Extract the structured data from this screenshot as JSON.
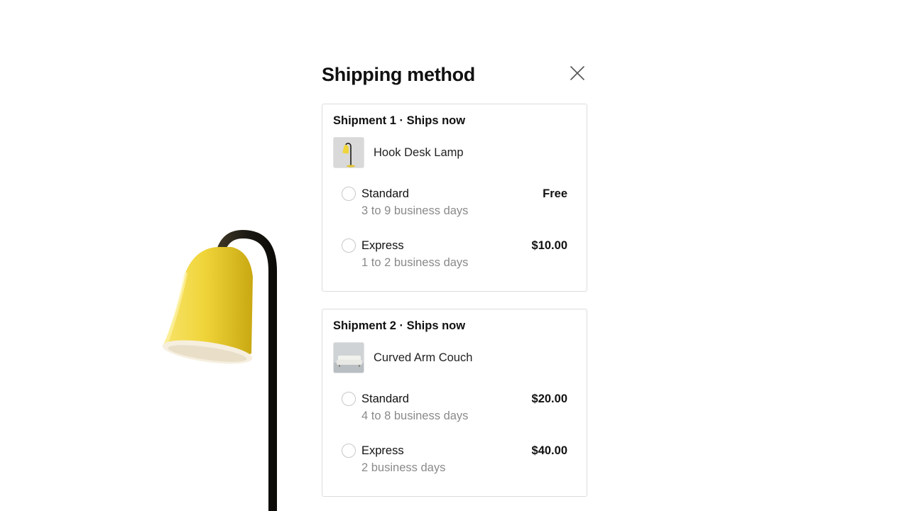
{
  "modal": {
    "title": "Shipping method",
    "close_icon": "close-icon"
  },
  "shipments": [
    {
      "title": "Shipment 1 · Ships now",
      "product": {
        "name": "Hook Desk Lamp",
        "thumbnail": "lamp-thumbnail"
      },
      "options": [
        {
          "label": "Standard",
          "description": "3 to 9 business days",
          "price": "Free"
        },
        {
          "label": "Express",
          "description": "1 to 2 business days",
          "price": "$10.00"
        }
      ]
    },
    {
      "title": "Shipment 2 · Ships now",
      "product": {
        "name": "Curved Arm Couch",
        "thumbnail": "couch-thumbnail"
      },
      "options": [
        {
          "label": "Standard",
          "description": "4 to 8 business days",
          "price": "$20.00"
        },
        {
          "label": "Express",
          "description": "2 business days",
          "price": "$40.00"
        }
      ]
    }
  ],
  "colors": {
    "lamp_shade": "#f0d53a",
    "lamp_pole": "#1c1a14",
    "border": "#dcdcdc",
    "muted_text": "#8a8a8a"
  }
}
